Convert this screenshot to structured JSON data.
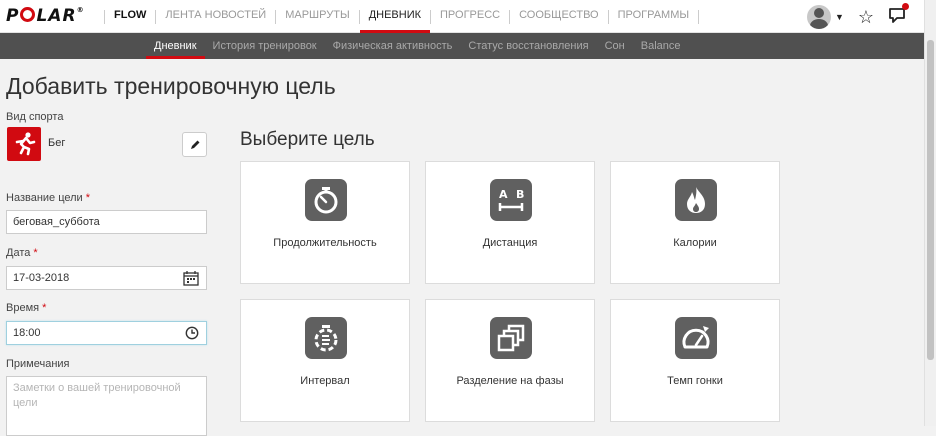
{
  "brand": {
    "logo": "POLAR",
    "product": "FLOW"
  },
  "main_nav": [
    "ЛЕНТА НОВОСТЕЙ",
    "МАРШРУТЫ",
    "ДНЕВНИК",
    "ПРОГРЕСС",
    "СООБЩЕСТВО",
    "ПРОГРАММЫ"
  ],
  "main_nav_active": "ДНЕВНИК",
  "sub_nav": [
    "Дневник",
    "История тренировок",
    "Физическая активность",
    "Статус восстановления",
    "Сон",
    "Balance"
  ],
  "sub_nav_active": "Дневник",
  "page": {
    "title": "Добавить тренировочную цель"
  },
  "form": {
    "sport_label": "Вид спорта",
    "sport_value": "Бег",
    "goal_name_label": "Название цели",
    "goal_name_value": "беговая_суббота",
    "date_label": "Дата",
    "date_value": "17-03-2018",
    "time_label": "Время",
    "time_value": "18:00",
    "notes_label": "Примечания",
    "notes_placeholder": "Заметки о вашей тренировочной цели",
    "required_mark": "*"
  },
  "goals": {
    "title": "Выберите цель",
    "tiles": [
      {
        "label": "Продолжительность",
        "icon": "stopwatch-icon"
      },
      {
        "label": "Дистанция",
        "icon": "distance-ab-icon"
      },
      {
        "label": "Калории",
        "icon": "flame-icon"
      },
      {
        "label": "Интервал",
        "icon": "interval-timer-icon"
      },
      {
        "label": "Разделение на фазы",
        "icon": "phases-icon"
      },
      {
        "label": "Темп гонки",
        "icon": "race-pace-icon"
      }
    ],
    "distance_icon_letters": {
      "a": "A",
      "b": "B"
    }
  },
  "colors": {
    "accent": "#d10a11",
    "subnav_bg": "#505050",
    "tile_icon_bg": "#606060"
  }
}
